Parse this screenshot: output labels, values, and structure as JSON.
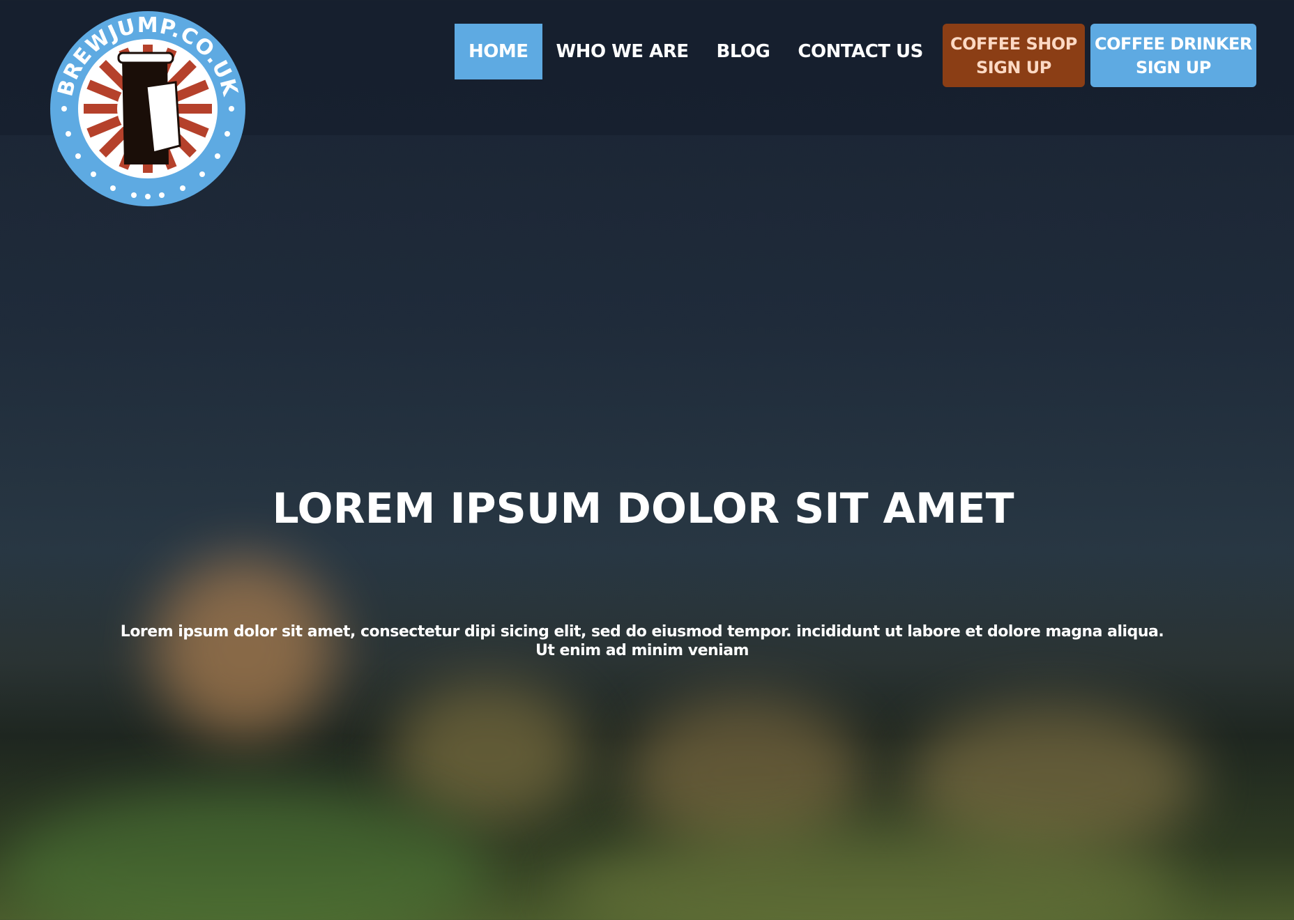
{
  "logo": {
    "text": "BREWJUMP.CO.UK"
  },
  "nav": {
    "items": [
      {
        "label": "HOME",
        "active": true
      },
      {
        "label": "WHO WE ARE"
      },
      {
        "label": "BLOG"
      },
      {
        "label": "CONTACT US"
      }
    ],
    "shop_signup": {
      "line1": "COFFEE SHOP",
      "line2": "SIGN UP"
    },
    "drinker_signup": {
      "line1": "COFFEE DRINKER",
      "line2": "SIGN UP"
    }
  },
  "hero": {
    "title": "LOREM IPSUM DOLOR SIT AMET",
    "text": "Lorem ipsum dolor sit amet, consectetur dipi sicing elit, sed do eiusmod tempor. incididunt ut labore et dolore magna aliqua. Ut enim ad minim veniam"
  },
  "colors": {
    "accent": "#5eaae2",
    "shop": "#8b3e15"
  }
}
